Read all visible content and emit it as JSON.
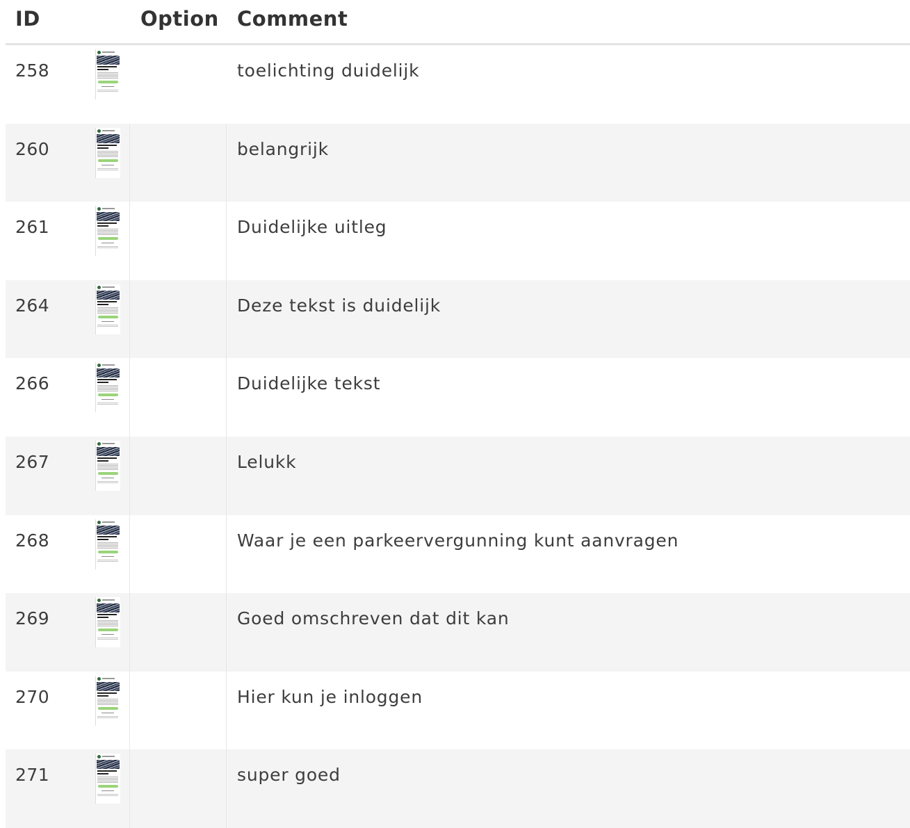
{
  "table": {
    "headers": {
      "id": "ID",
      "option": "Option",
      "comment": "Comment"
    },
    "rows": [
      {
        "id": "258",
        "option": "",
        "thumbnail": "screenshot-thumbnail",
        "comment": "toelichting duidelijk"
      },
      {
        "id": "260",
        "option": "",
        "thumbnail": "screenshot-thumbnail",
        "comment": "belangrijk"
      },
      {
        "id": "261",
        "option": "",
        "thumbnail": "screenshot-thumbnail",
        "comment": "Duidelijke uitleg"
      },
      {
        "id": "264",
        "option": "",
        "thumbnail": "screenshot-thumbnail",
        "comment": "Deze tekst is duidelijk"
      },
      {
        "id": "266",
        "option": "",
        "thumbnail": "screenshot-thumbnail",
        "comment": "Duidelijke tekst"
      },
      {
        "id": "267",
        "option": "",
        "thumbnail": "screenshot-thumbnail",
        "comment": "Lelukk"
      },
      {
        "id": "268",
        "option": "",
        "thumbnail": "screenshot-thumbnail",
        "comment": "Waar je een parkeervergunning kunt aanvragen"
      },
      {
        "id": "269",
        "option": "",
        "thumbnail": "screenshot-thumbnail",
        "comment": "Goed omschreven dat dit kan"
      },
      {
        "id": "270",
        "option": "",
        "thumbnail": "screenshot-thumbnail",
        "comment": "Hier kun je inloggen"
      },
      {
        "id": "271",
        "option": "",
        "thumbnail": "screenshot-thumbnail",
        "comment": "super goed"
      }
    ]
  },
  "colors": {
    "row_alt_background": "#f4f4f4",
    "header_rule": "#e3e3e3",
    "text": "#3d3d3d",
    "thumbnail_button": "#9ad47a"
  }
}
